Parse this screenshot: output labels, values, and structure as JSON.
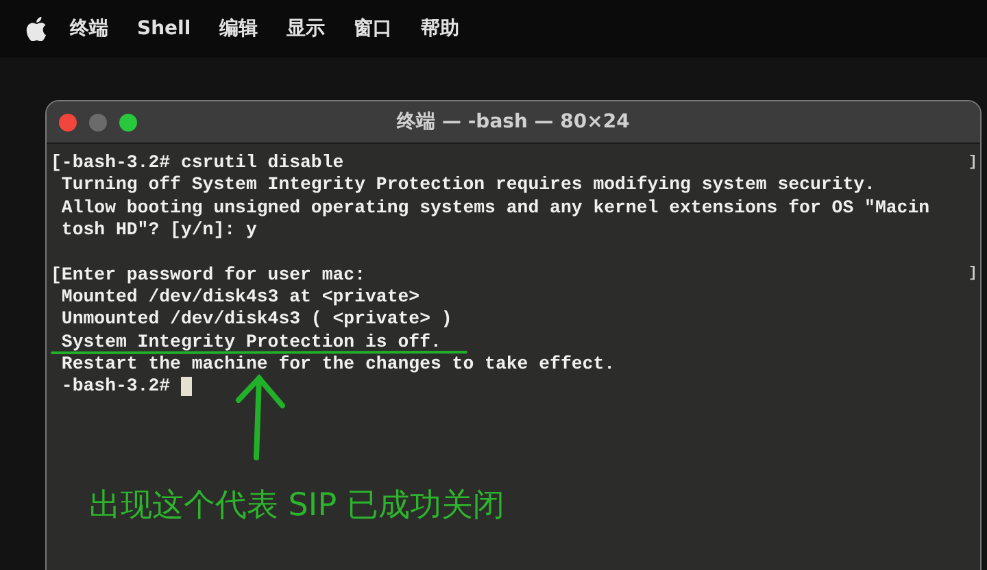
{
  "menu_bar": {
    "items": [
      "终端",
      "Shell",
      "编辑",
      "显示",
      "窗口",
      "帮助"
    ]
  },
  "window": {
    "title": "终端 — -bash — 80×24"
  },
  "terminal": {
    "lines": [
      {
        "text": "[-bash-3.2# csrutil disable",
        "right_mark": "]",
        "cursor": false
      },
      {
        "text": " Turning off System Integrity Protection requires modifying system security.",
        "cursor": false
      },
      {
        "text": " Allow booting unsigned operating systems and any kernel extensions for OS \"Macin",
        "cursor": false
      },
      {
        "text": " tosh HD\"? [y/n]: y",
        "cursor": false
      },
      {
        "cursor": false
      },
      {
        "text": "[Enter password for user mac:",
        "right_mark": "]",
        "cursor": false
      },
      {
        "text": " Mounted /dev/disk4s3 at <private>",
        "cursor": false
      },
      {
        "text": " Unmounted /dev/disk4s3 ( <private> )",
        "cursor": false
      },
      {
        "text": " System Integrity Protection is off.",
        "cursor": false
      },
      {
        "text": " Restart the machine for the changes to take effect.",
        "cursor": false
      },
      {
        "text": " -bash-3.2#",
        "cursor": true
      }
    ]
  },
  "annotation": {
    "text": "出现这个代表 SIP 已成功关闭"
  }
}
